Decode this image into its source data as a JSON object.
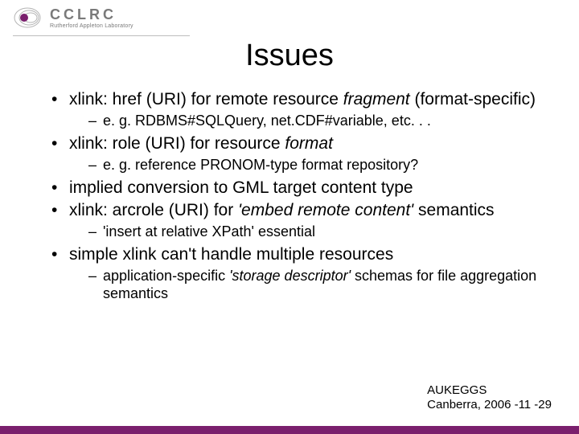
{
  "logo": {
    "letters": "CCLRC",
    "subtitle": "Rutherford Appleton Laboratory"
  },
  "title": "Issues",
  "bullets": [
    {
      "pre": "xlink: href (URI) for remote resource ",
      "em": "fragment",
      "post": " (format-specific)",
      "sub": [
        "e. g. RDBMS#SQLQuery, net.CDF#variable, etc. . ."
      ]
    },
    {
      "pre": "xlink: role (URI) for resource ",
      "em": "format",
      "post": "",
      "sub": [
        "e. g. reference PRONOM-type format repository?"
      ]
    },
    {
      "pre": "implied conversion to GML target content type",
      "em": "",
      "post": "",
      "sub": []
    },
    {
      "pre": "xlink: arcrole (URI) for ",
      "em": "'embed remote content'",
      "post": " semantics",
      "sub": [
        "'insert at relative XPath' essential"
      ]
    },
    {
      "pre": "simple xlink can't handle multiple resources",
      "em": "",
      "post": "",
      "sub": [
        {
          "pre": "application-specific ",
          "em": "'storage descriptor'",
          "post": " schemas for file aggregation semantics"
        }
      ]
    }
  ],
  "footer": {
    "line1": "AUKEGGS",
    "line2": "Canberra, 2006 -11 -29"
  },
  "colors": {
    "accent": "#7a1f6d"
  }
}
